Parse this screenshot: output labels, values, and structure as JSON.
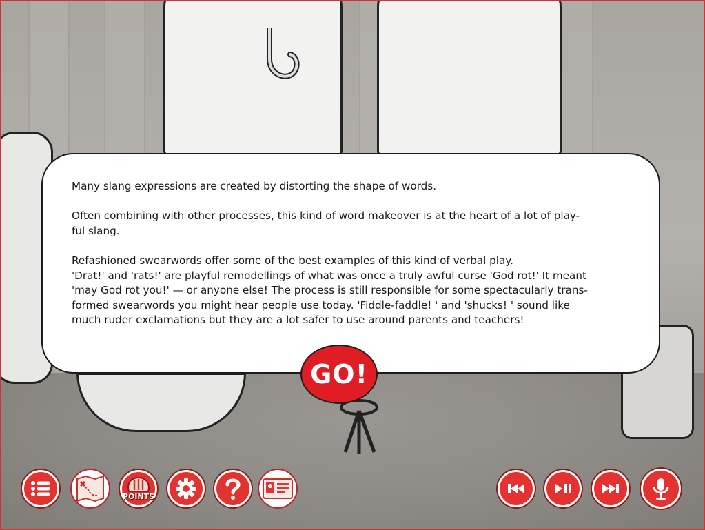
{
  "info": {
    "para1": "Many slang expressions are created by distorting the shape of words.",
    "para2_line1": "Often combining with other processes, this kind of word makeover is at the heart of a lot of play-",
    "para2_line2": "ful slang.",
    "para3_line1": "Refashioned swearwords offer some of the best examples of this kind of verbal play.",
    "para3_line2": "'Drat!' and 'rats!' are playful remodellings of what was once a truly awful curse 'God rot!' It meant",
    "para3_line3": "'may God rot you!' — or anyone else!  The process is still responsible for some spectacularly trans-",
    "para3_line4": "formed swearwords you might hear people use today.  'Fiddle-faddle! ' and 'shucks! ' sound like",
    "para3_line5": "much ruder exclamations but they are a lot safer to use around parents and teachers!"
  },
  "go_button": {
    "label": "GO!"
  },
  "toolbar": {
    "points_label": "POINTS",
    "left_buttons": [
      "menu-list-icon",
      "treasure-map-icon",
      "points-icon",
      "gear-icon",
      "help-icon",
      "id-card-icon"
    ],
    "right_buttons": [
      "skip-back-icon",
      "play-pause-icon",
      "skip-forward-icon",
      "microphone-icon"
    ]
  },
  "colors": {
    "accent": "#e3322f",
    "go": "#e01c24",
    "card": "#ffffff"
  }
}
